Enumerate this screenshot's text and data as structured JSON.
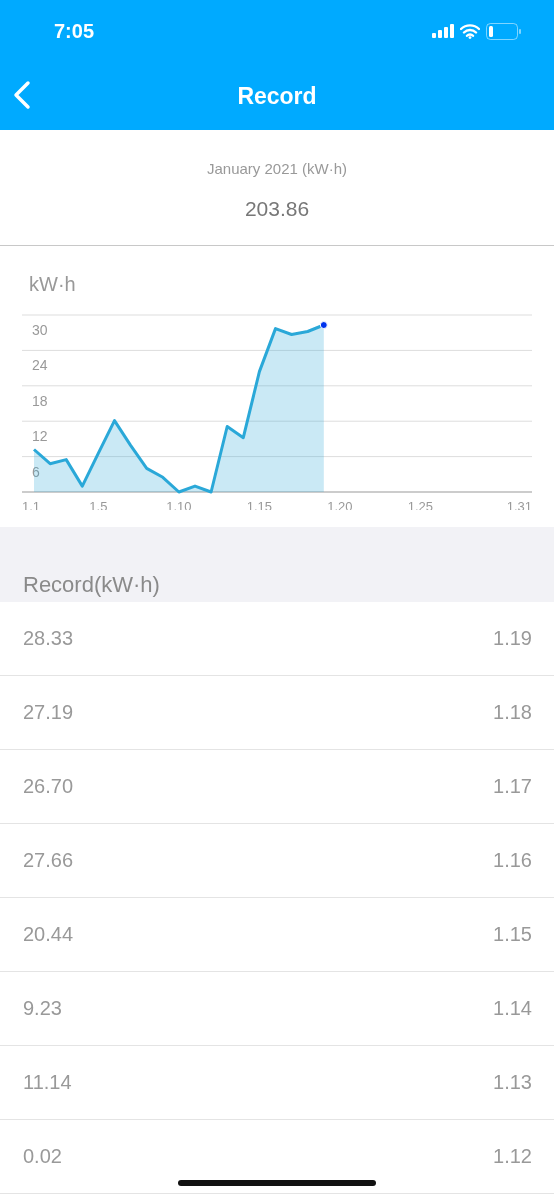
{
  "status_bar": {
    "time": "7:05"
  },
  "nav": {
    "title": "Record"
  },
  "summary": {
    "label": "January 2021 (kW·h)",
    "value": "203.86"
  },
  "chart": {
    "unit": "kW·h",
    "chart_data": {
      "type": "area",
      "categories": [
        "1.1",
        null,
        null,
        null,
        "1.5",
        null,
        null,
        null,
        null,
        "1.10",
        null,
        null,
        null,
        null,
        "1.15",
        null,
        null,
        null,
        null,
        "1.20",
        null,
        null,
        null,
        null,
        "1.25",
        null,
        null,
        null,
        null,
        null,
        "1.31"
      ],
      "series": [
        {
          "color": "#2aa8d8",
          "values": [
            7.2,
            4.8,
            5.5,
            1.0,
            6.6,
            12.1,
            7.9,
            4.0,
            2.5,
            0,
            1.0,
            0,
            11.1,
            9.2,
            20.4,
            27.7,
            26.7,
            27.2,
            28.3,
            null,
            null,
            null,
            null,
            null,
            null,
            null,
            null,
            null,
            null,
            null,
            null
          ]
        }
      ],
      "ylim": [
        0,
        30
      ],
      "grid": true,
      "yticks": [
        6,
        12,
        18,
        24,
        30
      ]
    }
  },
  "records": {
    "title": "Record(kW·h)",
    "rows": [
      {
        "value": "28.33",
        "date": "1.19"
      },
      {
        "value": "27.19",
        "date": "1.18"
      },
      {
        "value": "26.70",
        "date": "1.17"
      },
      {
        "value": "27.66",
        "date": "1.16"
      },
      {
        "value": "20.44",
        "date": "1.15"
      },
      {
        "value": "9.23",
        "date": "1.14"
      },
      {
        "value": "11.14",
        "date": "1.13"
      },
      {
        "value": "0.02",
        "date": "1.12"
      }
    ]
  }
}
